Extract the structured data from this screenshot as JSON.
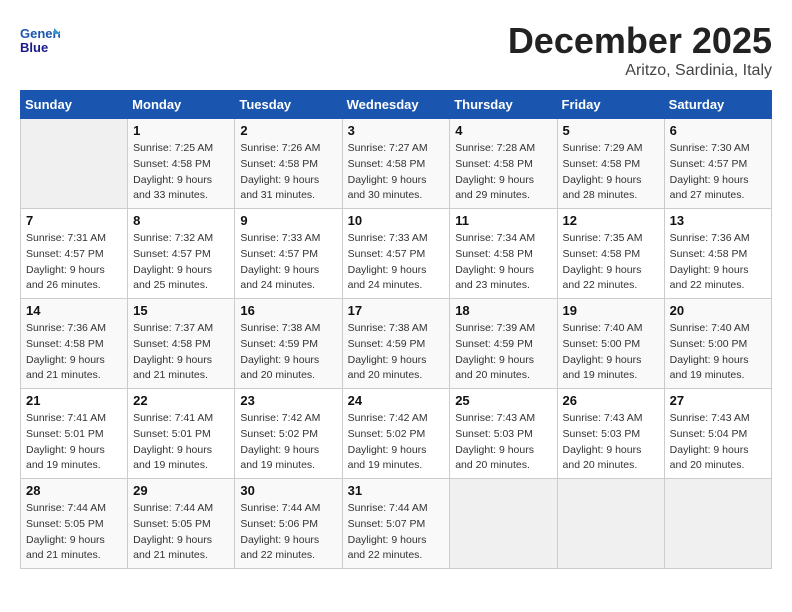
{
  "logo": {
    "line1": "General",
    "line2": "Blue"
  },
  "title": "December 2025",
  "subtitle": "Aritzo, Sardinia, Italy",
  "weekdays": [
    "Sunday",
    "Monday",
    "Tuesday",
    "Wednesday",
    "Thursday",
    "Friday",
    "Saturday"
  ],
  "weeks": [
    [
      {
        "day": "",
        "sunrise": "",
        "sunset": "",
        "daylight": ""
      },
      {
        "day": "1",
        "sunrise": "Sunrise: 7:25 AM",
        "sunset": "Sunset: 4:58 PM",
        "daylight": "Daylight: 9 hours and 33 minutes."
      },
      {
        "day": "2",
        "sunrise": "Sunrise: 7:26 AM",
        "sunset": "Sunset: 4:58 PM",
        "daylight": "Daylight: 9 hours and 31 minutes."
      },
      {
        "day": "3",
        "sunrise": "Sunrise: 7:27 AM",
        "sunset": "Sunset: 4:58 PM",
        "daylight": "Daylight: 9 hours and 30 minutes."
      },
      {
        "day": "4",
        "sunrise": "Sunrise: 7:28 AM",
        "sunset": "Sunset: 4:58 PM",
        "daylight": "Daylight: 9 hours and 29 minutes."
      },
      {
        "day": "5",
        "sunrise": "Sunrise: 7:29 AM",
        "sunset": "Sunset: 4:58 PM",
        "daylight": "Daylight: 9 hours and 28 minutes."
      },
      {
        "day": "6",
        "sunrise": "Sunrise: 7:30 AM",
        "sunset": "Sunset: 4:57 PM",
        "daylight": "Daylight: 9 hours and 27 minutes."
      }
    ],
    [
      {
        "day": "7",
        "sunrise": "Sunrise: 7:31 AM",
        "sunset": "Sunset: 4:57 PM",
        "daylight": "Daylight: 9 hours and 26 minutes."
      },
      {
        "day": "8",
        "sunrise": "Sunrise: 7:32 AM",
        "sunset": "Sunset: 4:57 PM",
        "daylight": "Daylight: 9 hours and 25 minutes."
      },
      {
        "day": "9",
        "sunrise": "Sunrise: 7:33 AM",
        "sunset": "Sunset: 4:57 PM",
        "daylight": "Daylight: 9 hours and 24 minutes."
      },
      {
        "day": "10",
        "sunrise": "Sunrise: 7:33 AM",
        "sunset": "Sunset: 4:57 PM",
        "daylight": "Daylight: 9 hours and 24 minutes."
      },
      {
        "day": "11",
        "sunrise": "Sunrise: 7:34 AM",
        "sunset": "Sunset: 4:58 PM",
        "daylight": "Daylight: 9 hours and 23 minutes."
      },
      {
        "day": "12",
        "sunrise": "Sunrise: 7:35 AM",
        "sunset": "Sunset: 4:58 PM",
        "daylight": "Daylight: 9 hours and 22 minutes."
      },
      {
        "day": "13",
        "sunrise": "Sunrise: 7:36 AM",
        "sunset": "Sunset: 4:58 PM",
        "daylight": "Daylight: 9 hours and 22 minutes."
      }
    ],
    [
      {
        "day": "14",
        "sunrise": "Sunrise: 7:36 AM",
        "sunset": "Sunset: 4:58 PM",
        "daylight": "Daylight: 9 hours and 21 minutes."
      },
      {
        "day": "15",
        "sunrise": "Sunrise: 7:37 AM",
        "sunset": "Sunset: 4:58 PM",
        "daylight": "Daylight: 9 hours and 21 minutes."
      },
      {
        "day": "16",
        "sunrise": "Sunrise: 7:38 AM",
        "sunset": "Sunset: 4:59 PM",
        "daylight": "Daylight: 9 hours and 20 minutes."
      },
      {
        "day": "17",
        "sunrise": "Sunrise: 7:38 AM",
        "sunset": "Sunset: 4:59 PM",
        "daylight": "Daylight: 9 hours and 20 minutes."
      },
      {
        "day": "18",
        "sunrise": "Sunrise: 7:39 AM",
        "sunset": "Sunset: 4:59 PM",
        "daylight": "Daylight: 9 hours and 20 minutes."
      },
      {
        "day": "19",
        "sunrise": "Sunrise: 7:40 AM",
        "sunset": "Sunset: 5:00 PM",
        "daylight": "Daylight: 9 hours and 19 minutes."
      },
      {
        "day": "20",
        "sunrise": "Sunrise: 7:40 AM",
        "sunset": "Sunset: 5:00 PM",
        "daylight": "Daylight: 9 hours and 19 minutes."
      }
    ],
    [
      {
        "day": "21",
        "sunrise": "Sunrise: 7:41 AM",
        "sunset": "Sunset: 5:01 PM",
        "daylight": "Daylight: 9 hours and 19 minutes."
      },
      {
        "day": "22",
        "sunrise": "Sunrise: 7:41 AM",
        "sunset": "Sunset: 5:01 PM",
        "daylight": "Daylight: 9 hours and 19 minutes."
      },
      {
        "day": "23",
        "sunrise": "Sunrise: 7:42 AM",
        "sunset": "Sunset: 5:02 PM",
        "daylight": "Daylight: 9 hours and 19 minutes."
      },
      {
        "day": "24",
        "sunrise": "Sunrise: 7:42 AM",
        "sunset": "Sunset: 5:02 PM",
        "daylight": "Daylight: 9 hours and 19 minutes."
      },
      {
        "day": "25",
        "sunrise": "Sunrise: 7:43 AM",
        "sunset": "Sunset: 5:03 PM",
        "daylight": "Daylight: 9 hours and 20 minutes."
      },
      {
        "day": "26",
        "sunrise": "Sunrise: 7:43 AM",
        "sunset": "Sunset: 5:03 PM",
        "daylight": "Daylight: 9 hours and 20 minutes."
      },
      {
        "day": "27",
        "sunrise": "Sunrise: 7:43 AM",
        "sunset": "Sunset: 5:04 PM",
        "daylight": "Daylight: 9 hours and 20 minutes."
      }
    ],
    [
      {
        "day": "28",
        "sunrise": "Sunrise: 7:44 AM",
        "sunset": "Sunset: 5:05 PM",
        "daylight": "Daylight: 9 hours and 21 minutes."
      },
      {
        "day": "29",
        "sunrise": "Sunrise: 7:44 AM",
        "sunset": "Sunset: 5:05 PM",
        "daylight": "Daylight: 9 hours and 21 minutes."
      },
      {
        "day": "30",
        "sunrise": "Sunrise: 7:44 AM",
        "sunset": "Sunset: 5:06 PM",
        "daylight": "Daylight: 9 hours and 22 minutes."
      },
      {
        "day": "31",
        "sunrise": "Sunrise: 7:44 AM",
        "sunset": "Sunset: 5:07 PM",
        "daylight": "Daylight: 9 hours and 22 minutes."
      },
      {
        "day": "",
        "sunrise": "",
        "sunset": "",
        "daylight": ""
      },
      {
        "day": "",
        "sunrise": "",
        "sunset": "",
        "daylight": ""
      },
      {
        "day": "",
        "sunrise": "",
        "sunset": "",
        "daylight": ""
      }
    ]
  ]
}
